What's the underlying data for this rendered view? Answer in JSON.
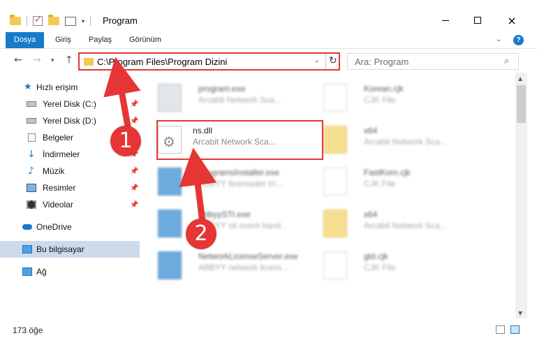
{
  "window": {
    "title": "Program",
    "controls": {
      "minimize": "minimize",
      "maximize": "maximize",
      "close": "×"
    }
  },
  "ribbon": {
    "tabs": [
      "Dosya",
      "Giriş",
      "Paylaş",
      "Görünüm"
    ],
    "help": "?"
  },
  "address": {
    "path": "C:\\Program Files\\Program Dizini",
    "search_placeholder": "Ara: Program"
  },
  "sidebar": {
    "items": [
      {
        "label": "Hızlı erişim",
        "icon": "star-icon"
      },
      {
        "label": "Yerel Disk (C:)",
        "icon": "disk-icon",
        "pinned": true
      },
      {
        "label": "Yerel Disk (D:)",
        "icon": "disk-icon",
        "pinned": true
      },
      {
        "label": "Belgeler",
        "icon": "documents-icon",
        "pinned": true
      },
      {
        "label": "İndirmeler",
        "icon": "download-icon",
        "pinned": true
      },
      {
        "label": "Müzik",
        "icon": "music-icon",
        "pinned": true
      },
      {
        "label": "Resimler",
        "icon": "pictures-icon",
        "pinned": true
      },
      {
        "label": "Videolar",
        "icon": "videos-icon",
        "pinned": true
      },
      {
        "label": "OneDrive",
        "icon": "onedrive-icon"
      },
      {
        "label": "Bu bilgisayar",
        "icon": "computer-icon",
        "selected": true
      },
      {
        "label": "Ağ",
        "icon": "network-icon"
      }
    ]
  },
  "files": {
    "items": [
      {
        "name": "program.exe",
        "desc": "Arcabit Network Sca...",
        "type": "exe"
      },
      {
        "name": "Korean.cjk",
        "desc": "CJK File",
        "type": "page"
      },
      {
        "name": "ns.dll",
        "desc": "Arcabit Network Sca...",
        "type": "dll",
        "highlighted": true
      },
      {
        "name": "x64",
        "desc": "Arcabit Network Sca...",
        "type": "folder"
      },
      {
        "name": "ProgramsInstaller.exe",
        "desc": "ABBYY finereader tri...",
        "type": "exe-blue"
      },
      {
        "name": "FastKorn.cjk",
        "desc": "CJK File",
        "type": "page"
      },
      {
        "name": "AbbyySTI.exe",
        "desc": "ABBYY sti event hand...",
        "type": "exe-blue"
      },
      {
        "name": "x64",
        "desc": "Arcabit Network Sca...",
        "type": "folder"
      },
      {
        "name": "NetworkLicenseServer.exe",
        "desc": "ABBYY network licens...",
        "type": "exe-blue"
      },
      {
        "name": "gtd.cjk",
        "desc": "CJK File",
        "type": "page"
      }
    ]
  },
  "status": {
    "count": "173 öğe"
  },
  "annotations": {
    "step1": "1",
    "step2": "2",
    "color": "#e53535"
  },
  "colors": {
    "accent": "#1979ca",
    "selection": "#ccdbeb",
    "annotation": "#e53535"
  }
}
